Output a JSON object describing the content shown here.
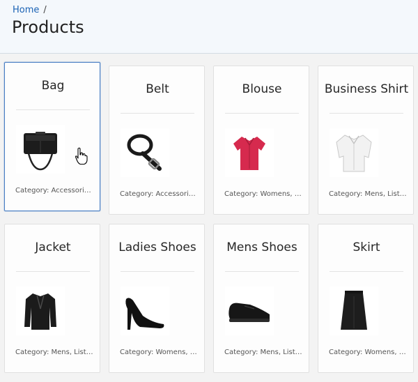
{
  "breadcrumb": {
    "home": "Home",
    "separator": "/"
  },
  "page": {
    "title": "Products"
  },
  "products": [
    {
      "name": "Bag",
      "category": "Category: Accessories, List Price: ...",
      "icon": "bag-icon"
    },
    {
      "name": "Belt",
      "category": "Category: Accessories, List Price: ...",
      "icon": "belt-icon"
    },
    {
      "name": "Blouse",
      "category": "Category: Womens, List Price: ...",
      "icon": "blouse-icon"
    },
    {
      "name": "Business Shirt",
      "category": "Category: Mens, List Price: ...",
      "icon": "shirt-icon"
    },
    {
      "name": "Jacket",
      "category": "Category: Mens, List Price: ...",
      "icon": "jacket-icon"
    },
    {
      "name": "Ladies Shoes",
      "category": "Category: Womens, List Price: ...",
      "icon": "ladies-shoe-icon"
    },
    {
      "name": "Mens Shoes",
      "category": "Category: Mens, List Price: ...",
      "icon": "mens-shoe-icon"
    },
    {
      "name": "Skirt",
      "category": "Category: Womens, List Price: ...",
      "icon": "skirt-icon"
    }
  ],
  "colors": {
    "accent": "#1a62b4",
    "focus_border": "#4a7fc4",
    "header_bg": "#f4f8fc",
    "page_bg": "#f3f3f3"
  }
}
